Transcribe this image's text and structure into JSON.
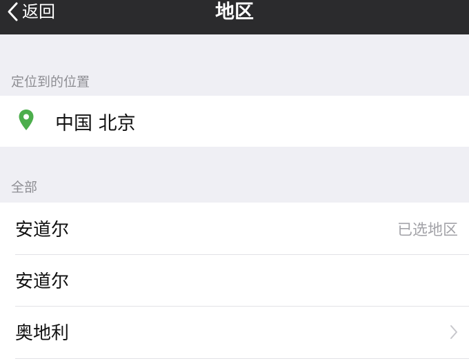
{
  "nav": {
    "back_label": "返回",
    "title": "地区",
    "back_icon": "chevron-left-icon"
  },
  "located": {
    "header": "定位到的位置",
    "location": "中国 北京",
    "icon": "location-pin-icon",
    "icon_color": "#4cae4c"
  },
  "all": {
    "header": "全部",
    "items": [
      {
        "label": "安道尔",
        "detail": "已选地区"
      },
      {
        "label": "安道尔"
      },
      {
        "label": "奥地利",
        "chevron": "chevron-right-icon"
      }
    ]
  }
}
